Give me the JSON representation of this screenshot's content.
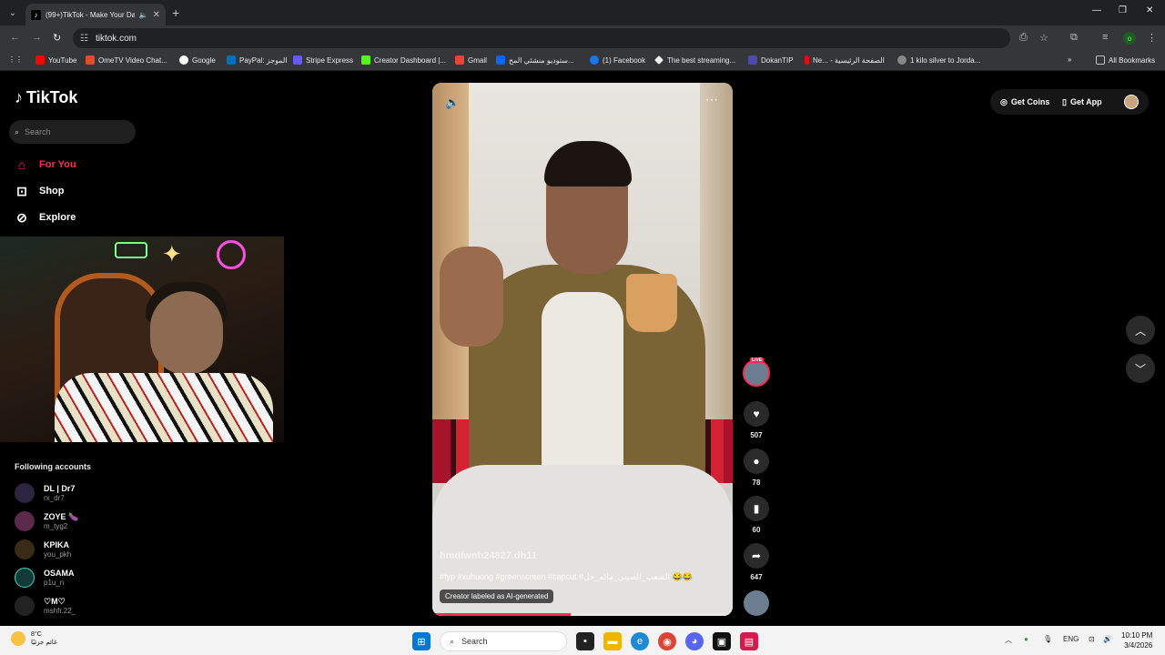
{
  "browser": {
    "tab_title": "(99+)TikTok - Make Your Da",
    "url": "tiktok.com",
    "bookmarks": [
      "YouTube",
      "OmeTV Video Chat...",
      "Google",
      "PayPal: الموجز",
      "Stripe Express",
      "Creator Dashboard |...",
      "Gmail",
      "ستوديو منشئي المح...",
      "(1) Facebook",
      "The best streaming...",
      "DokanTIP",
      "Ne... - الصفحة الرئيسية",
      "1 kilo silver to Jorda..."
    ],
    "all_bookmarks": "All Bookmarks",
    "profile_initial": "o"
  },
  "tiktok": {
    "logo": "TikTok",
    "search_placeholder": "Search",
    "nav": {
      "for_you": "For You",
      "shop": "Shop",
      "explore": "Explore"
    },
    "following_title": "Following accounts",
    "accounts": [
      {
        "name": "DL | Dr7",
        "handle": "rx_dr7"
      },
      {
        "name": "ZOYE 🍆",
        "handle": "m_tyg2"
      },
      {
        "name": "KPIKA",
        "handle": "you_pkh"
      },
      {
        "name": "OSAMA",
        "handle": "p1u_n"
      },
      {
        "name": "♡M♡",
        "handle": "mshfr.22_"
      }
    ],
    "get_coins": "Get Coins",
    "get_app": "Get App",
    "video": {
      "username": "hmdlwnh24827.dh11",
      "tags": "#fyp #xuhuong #greenscreen #capcut #الشعب_الصيني_ماله_حل 😂😂",
      "ai_label": "Creator labeled as AI-generated",
      "progress": 0.46
    },
    "actions": {
      "live": "LIVE",
      "likes": "507",
      "comments": "78",
      "saves": "60",
      "shares": "647"
    }
  },
  "taskbar": {
    "temp": "8°C",
    "weather": "غائم جزئيًا",
    "search": "Search",
    "lang": "ENG",
    "time": "10:10 PM",
    "date": "3/4/2026"
  },
  "colors": {
    "accent": "#fe2c55",
    "chrome_dark": "#202124",
    "chrome_mid": "#35363a"
  }
}
